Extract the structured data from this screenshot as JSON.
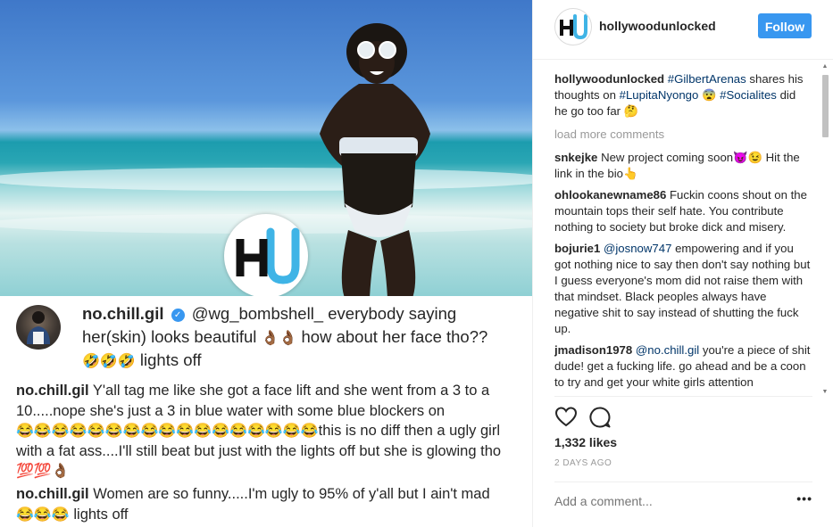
{
  "post": {
    "username": "no.chill.gil",
    "mention": "@wg_bombshell_",
    "caption_text": "everybody saying her(skin) looks beautiful",
    "caption_emoji1": "👌🏾👌🏾",
    "caption_text2": "how about her face tho??",
    "caption_emoji2": "🤣🤣🤣",
    "caption_text3": "lights off",
    "reply1_user": "no.chill.gil",
    "reply1_text": "Y'all tag me like she got a face lift and she went from a 3 to a 10.....nope she's just a 3 in blue water with some blue blockers on",
    "reply1_emoji": "😂😂😂😂😂😂😂😂😂😂😂😂😂😂😂😂😂",
    "reply1_text2": "this is no diff then a ugly girl with a fat ass....I'll still beat but just with the lights off but she is glowing tho",
    "reply1_emoji2": "💯💯👌🏾",
    "reply2_user": "no.chill.gil",
    "reply2_text": "Women are so funny.....I'm ugly to 95% of y'all but I ain't mad",
    "reply2_emoji": "😂😂😂",
    "reply2_text2": "lights off"
  },
  "header": {
    "username": "hollywoodunlocked",
    "follow_label": "Follow"
  },
  "caption": {
    "username": "hollywoodunlocked",
    "tag1": "#GilbertArenas",
    "text1": "shares his thoughts on",
    "tag2": "#LupitaNyongo",
    "emoji1": "😨",
    "tag3": "#Socialites",
    "text2": "did he go too far",
    "emoji2": "🤔"
  },
  "load_more": "load more comments",
  "comments": [
    {
      "user": "snkejke",
      "text": "New project coming soon😈😉 Hit the link in the bio👆"
    },
    {
      "user": "ohlookanewname86",
      "text": "Fuckin coons shout on the mountain tops their self hate. You contribute nothing to society but broke dick and misery."
    },
    {
      "user": "bojurie1",
      "mention": "@josnow747",
      "text": "empowering and if you got nothing nice to say then don't say nothing but I guess everyone's mom did not raise them with that mindset. Black peoples always have negative shit to say instead of shutting the fuck up."
    },
    {
      "user": "jmadison1978",
      "mention": "@no.chill.gil",
      "text": "you're a piece of shit dude! get a fucking life. go ahead and be a coon to try and get your white girls attention"
    }
  ],
  "likes": "1,332 likes",
  "age": "2 DAYS AGO",
  "comment_input": {
    "placeholder": "Add a comment..."
  },
  "more_label": "•••",
  "colors": {
    "accent": "#3897f0",
    "tag": "#003569",
    "muted": "#999999",
    "text": "#262626"
  },
  "icons": [
    "heart-icon",
    "comment-icon",
    "verified-icon",
    "more-icon"
  ]
}
